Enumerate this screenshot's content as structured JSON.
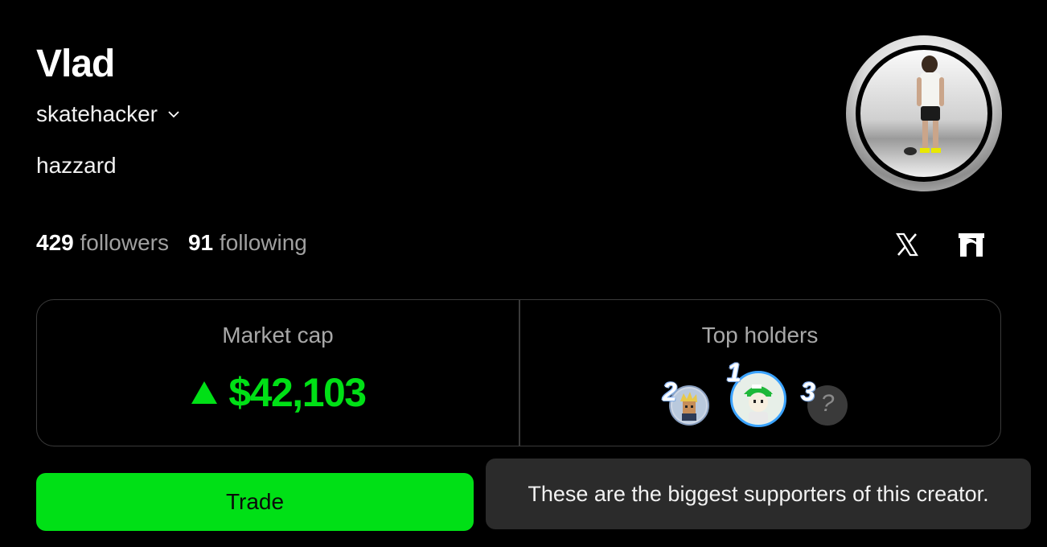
{
  "profile": {
    "display_name": "Vlad",
    "handle": "skatehacker",
    "bio": "hazzard",
    "followers_count": "429",
    "followers_label": "followers",
    "following_count": "91",
    "following_label": "following"
  },
  "social": {
    "icons": [
      "x-icon",
      "arch-icon"
    ]
  },
  "market": {
    "market_cap_label": "Market cap",
    "market_cap_value": "$42,103",
    "trend": "up",
    "accent_color": "#00e016"
  },
  "holders": {
    "label": "Top holders",
    "ranks": [
      "2",
      "1",
      "3"
    ],
    "unknown_glyph": "?"
  },
  "actions": {
    "trade_label": "Trade"
  },
  "tooltip": {
    "text": "These are the biggest supporters of this creator."
  }
}
